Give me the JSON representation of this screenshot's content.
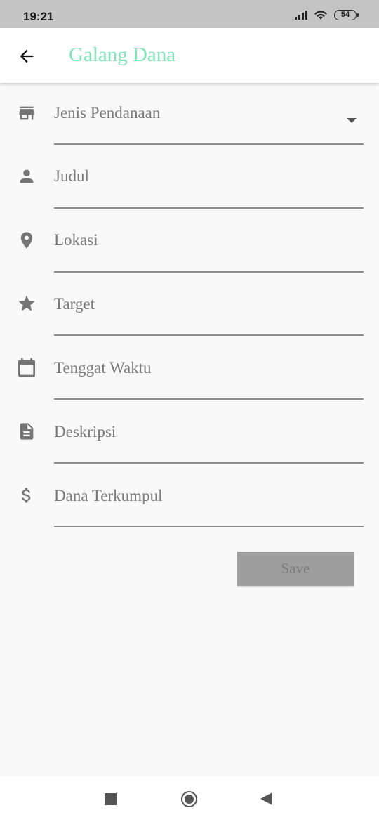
{
  "status_bar": {
    "time": "19:21",
    "battery": "54"
  },
  "app_bar": {
    "title": "Galang Dana",
    "back_icon": "arrow-left-icon",
    "title_color": "#7fe6b8"
  },
  "form": {
    "fields": [
      {
        "label": "Jenis Pendanaan",
        "icon": "store-icon",
        "type": "dropdown"
      },
      {
        "label": "Judul",
        "icon": "person-icon",
        "type": "text"
      },
      {
        "label": "Lokasi",
        "icon": "location-pin-icon",
        "type": "text"
      },
      {
        "label": "Target",
        "icon": "star-icon",
        "type": "text"
      },
      {
        "label": "Tenggat Waktu",
        "icon": "calendar-icon",
        "type": "date"
      },
      {
        "label": "Deskripsi",
        "icon": "document-icon",
        "type": "text"
      },
      {
        "label": "Dana Terkumpul",
        "icon": "dollar-icon",
        "type": "text"
      }
    ],
    "save_label": "Save"
  },
  "colors": {
    "accent": "#7fe6b8",
    "icon": "#757575",
    "underline": "#8c8c8c",
    "button_disabled": "#9e9e9e"
  }
}
